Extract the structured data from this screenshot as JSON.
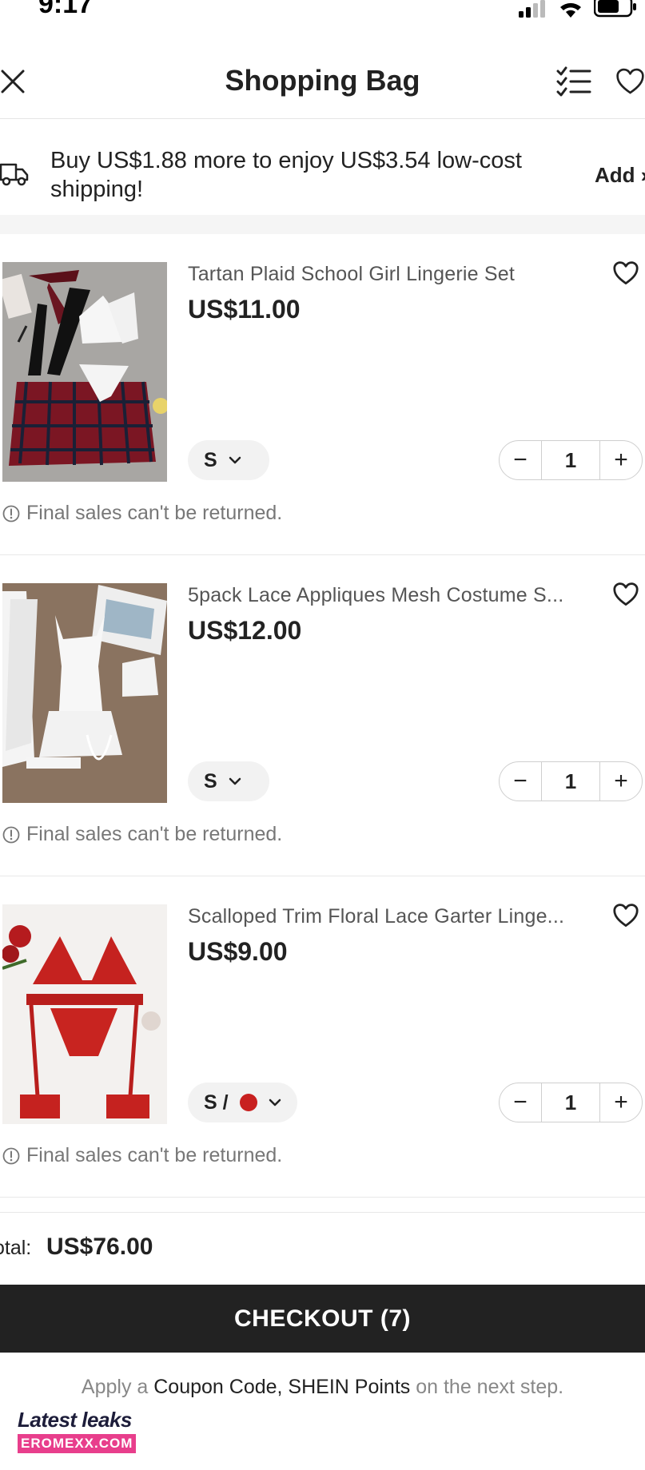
{
  "status_bar": {
    "time": "9:17",
    "icons": [
      "cellular-signal-icon",
      "wifi-icon",
      "battery-icon"
    ]
  },
  "header": {
    "title": "Shopping Bag",
    "left_icon": "close-icon",
    "right_icons": [
      "checklist-icon",
      "heart-icon"
    ]
  },
  "shipping_banner": {
    "icon": "truck-icon",
    "text": "Buy US$1.88 more to enjoy US$3.54 low-cost shipping!",
    "action_label": "Add"
  },
  "items": [
    {
      "title": "Tartan Plaid School Girl Lingerie Set",
      "price": "US$11.00",
      "size": "S",
      "quantity": "1",
      "note": "Final sales can't be returned."
    },
    {
      "title": "5pack Lace Appliques Mesh Costume S...",
      "price": "US$12.00",
      "size": "S",
      "quantity": "1",
      "note": "Final sales can't be returned."
    },
    {
      "title": "Scalloped Trim Floral Lace Garter Linge...",
      "price": "US$9.00",
      "size": "S /",
      "color_swatch": "#c8201f",
      "quantity": "1",
      "note": "Final sales can't be returned."
    }
  ],
  "footer": {
    "total_label": "otal:",
    "total_value": "US$76.00",
    "checkout_label": "CHECKOUT (7)",
    "coupon_prefix": "Apply a",
    "coupon_highlight": "Coupon Code, SHEIN Points",
    "coupon_suffix": "on the next step."
  },
  "watermark": {
    "line1": "Latest leaks",
    "line2": "EROMEXX.COM"
  },
  "colors": {
    "checkout_bg": "#222222",
    "accent_red": "#c8201f",
    "watermark_pink": "#e83e8c"
  }
}
